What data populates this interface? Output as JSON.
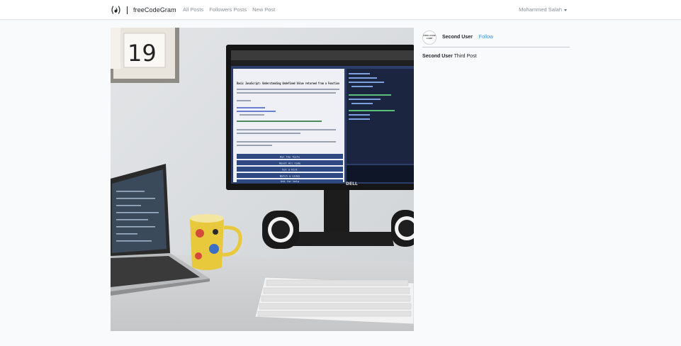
{
  "navbar": {
    "brand_name": "freeCodeGram",
    "links": [
      "All Posts",
      "Followers Posts",
      "New Post"
    ],
    "user_name": "Mohammed Salah"
  },
  "post": {
    "image_alt": "Desk setup with monitor, laptop, mug and keyboard",
    "author": {
      "name": "Second User",
      "avatar_text": "FREE CODE CAMP",
      "follow_label": "Follow"
    },
    "caption": {
      "username": "Second User",
      "text": "Third Post"
    }
  },
  "photo_text": {
    "calendar": "19",
    "monitor_brand": "DELL",
    "editor_title": "Basic JavaScript: Understanding Undefined Value returned from a Function",
    "buttons": [
      "Run the Tests",
      "Reset All Code",
      "Get a Hint",
      "Watch a video",
      "Ask for help"
    ]
  },
  "colors": {
    "link_blue": "#3490dc",
    "nav_muted": "#8a8f95",
    "page_bg": "#f8fafc"
  }
}
